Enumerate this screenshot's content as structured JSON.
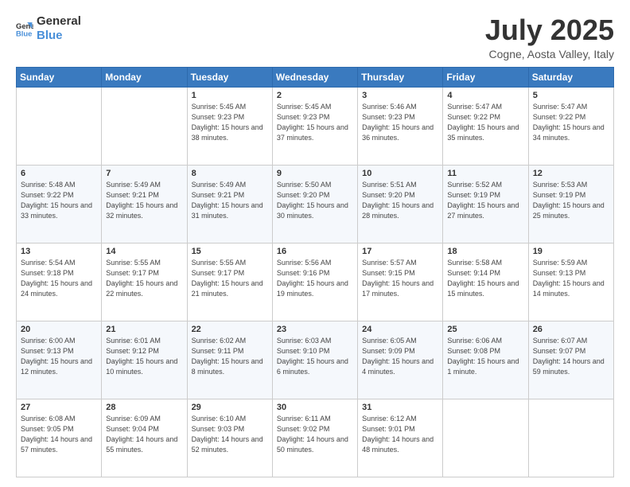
{
  "logo": {
    "general": "General",
    "blue": "Blue"
  },
  "title": {
    "month_year": "July 2025",
    "location": "Cogne, Aosta Valley, Italy"
  },
  "days_of_week": [
    "Sunday",
    "Monday",
    "Tuesday",
    "Wednesday",
    "Thursday",
    "Friday",
    "Saturday"
  ],
  "weeks": [
    [
      {
        "day": "",
        "sunrise": "",
        "sunset": "",
        "daylight": ""
      },
      {
        "day": "",
        "sunrise": "",
        "sunset": "",
        "daylight": ""
      },
      {
        "day": "1",
        "sunrise": "Sunrise: 5:45 AM",
        "sunset": "Sunset: 9:23 PM",
        "daylight": "Daylight: 15 hours and 38 minutes."
      },
      {
        "day": "2",
        "sunrise": "Sunrise: 5:45 AM",
        "sunset": "Sunset: 9:23 PM",
        "daylight": "Daylight: 15 hours and 37 minutes."
      },
      {
        "day": "3",
        "sunrise": "Sunrise: 5:46 AM",
        "sunset": "Sunset: 9:23 PM",
        "daylight": "Daylight: 15 hours and 36 minutes."
      },
      {
        "day": "4",
        "sunrise": "Sunrise: 5:47 AM",
        "sunset": "Sunset: 9:22 PM",
        "daylight": "Daylight: 15 hours and 35 minutes."
      },
      {
        "day": "5",
        "sunrise": "Sunrise: 5:47 AM",
        "sunset": "Sunset: 9:22 PM",
        "daylight": "Daylight: 15 hours and 34 minutes."
      }
    ],
    [
      {
        "day": "6",
        "sunrise": "Sunrise: 5:48 AM",
        "sunset": "Sunset: 9:22 PM",
        "daylight": "Daylight: 15 hours and 33 minutes."
      },
      {
        "day": "7",
        "sunrise": "Sunrise: 5:49 AM",
        "sunset": "Sunset: 9:21 PM",
        "daylight": "Daylight: 15 hours and 32 minutes."
      },
      {
        "day": "8",
        "sunrise": "Sunrise: 5:49 AM",
        "sunset": "Sunset: 9:21 PM",
        "daylight": "Daylight: 15 hours and 31 minutes."
      },
      {
        "day": "9",
        "sunrise": "Sunrise: 5:50 AM",
        "sunset": "Sunset: 9:20 PM",
        "daylight": "Daylight: 15 hours and 30 minutes."
      },
      {
        "day": "10",
        "sunrise": "Sunrise: 5:51 AM",
        "sunset": "Sunset: 9:20 PM",
        "daylight": "Daylight: 15 hours and 28 minutes."
      },
      {
        "day": "11",
        "sunrise": "Sunrise: 5:52 AM",
        "sunset": "Sunset: 9:19 PM",
        "daylight": "Daylight: 15 hours and 27 minutes."
      },
      {
        "day": "12",
        "sunrise": "Sunrise: 5:53 AM",
        "sunset": "Sunset: 9:19 PM",
        "daylight": "Daylight: 15 hours and 25 minutes."
      }
    ],
    [
      {
        "day": "13",
        "sunrise": "Sunrise: 5:54 AM",
        "sunset": "Sunset: 9:18 PM",
        "daylight": "Daylight: 15 hours and 24 minutes."
      },
      {
        "day": "14",
        "sunrise": "Sunrise: 5:55 AM",
        "sunset": "Sunset: 9:17 PM",
        "daylight": "Daylight: 15 hours and 22 minutes."
      },
      {
        "day": "15",
        "sunrise": "Sunrise: 5:55 AM",
        "sunset": "Sunset: 9:17 PM",
        "daylight": "Daylight: 15 hours and 21 minutes."
      },
      {
        "day": "16",
        "sunrise": "Sunrise: 5:56 AM",
        "sunset": "Sunset: 9:16 PM",
        "daylight": "Daylight: 15 hours and 19 minutes."
      },
      {
        "day": "17",
        "sunrise": "Sunrise: 5:57 AM",
        "sunset": "Sunset: 9:15 PM",
        "daylight": "Daylight: 15 hours and 17 minutes."
      },
      {
        "day": "18",
        "sunrise": "Sunrise: 5:58 AM",
        "sunset": "Sunset: 9:14 PM",
        "daylight": "Daylight: 15 hours and 15 minutes."
      },
      {
        "day": "19",
        "sunrise": "Sunrise: 5:59 AM",
        "sunset": "Sunset: 9:13 PM",
        "daylight": "Daylight: 15 hours and 14 minutes."
      }
    ],
    [
      {
        "day": "20",
        "sunrise": "Sunrise: 6:00 AM",
        "sunset": "Sunset: 9:13 PM",
        "daylight": "Daylight: 15 hours and 12 minutes."
      },
      {
        "day": "21",
        "sunrise": "Sunrise: 6:01 AM",
        "sunset": "Sunset: 9:12 PM",
        "daylight": "Daylight: 15 hours and 10 minutes."
      },
      {
        "day": "22",
        "sunrise": "Sunrise: 6:02 AM",
        "sunset": "Sunset: 9:11 PM",
        "daylight": "Daylight: 15 hours and 8 minutes."
      },
      {
        "day": "23",
        "sunrise": "Sunrise: 6:03 AM",
        "sunset": "Sunset: 9:10 PM",
        "daylight": "Daylight: 15 hours and 6 minutes."
      },
      {
        "day": "24",
        "sunrise": "Sunrise: 6:05 AM",
        "sunset": "Sunset: 9:09 PM",
        "daylight": "Daylight: 15 hours and 4 minutes."
      },
      {
        "day": "25",
        "sunrise": "Sunrise: 6:06 AM",
        "sunset": "Sunset: 9:08 PM",
        "daylight": "Daylight: 15 hours and 1 minute."
      },
      {
        "day": "26",
        "sunrise": "Sunrise: 6:07 AM",
        "sunset": "Sunset: 9:07 PM",
        "daylight": "Daylight: 14 hours and 59 minutes."
      }
    ],
    [
      {
        "day": "27",
        "sunrise": "Sunrise: 6:08 AM",
        "sunset": "Sunset: 9:05 PM",
        "daylight": "Daylight: 14 hours and 57 minutes."
      },
      {
        "day": "28",
        "sunrise": "Sunrise: 6:09 AM",
        "sunset": "Sunset: 9:04 PM",
        "daylight": "Daylight: 14 hours and 55 minutes."
      },
      {
        "day": "29",
        "sunrise": "Sunrise: 6:10 AM",
        "sunset": "Sunset: 9:03 PM",
        "daylight": "Daylight: 14 hours and 52 minutes."
      },
      {
        "day": "30",
        "sunrise": "Sunrise: 6:11 AM",
        "sunset": "Sunset: 9:02 PM",
        "daylight": "Daylight: 14 hours and 50 minutes."
      },
      {
        "day": "31",
        "sunrise": "Sunrise: 6:12 AM",
        "sunset": "Sunset: 9:01 PM",
        "daylight": "Daylight: 14 hours and 48 minutes."
      },
      {
        "day": "",
        "sunrise": "",
        "sunset": "",
        "daylight": ""
      },
      {
        "day": "",
        "sunrise": "",
        "sunset": "",
        "daylight": ""
      }
    ]
  ]
}
